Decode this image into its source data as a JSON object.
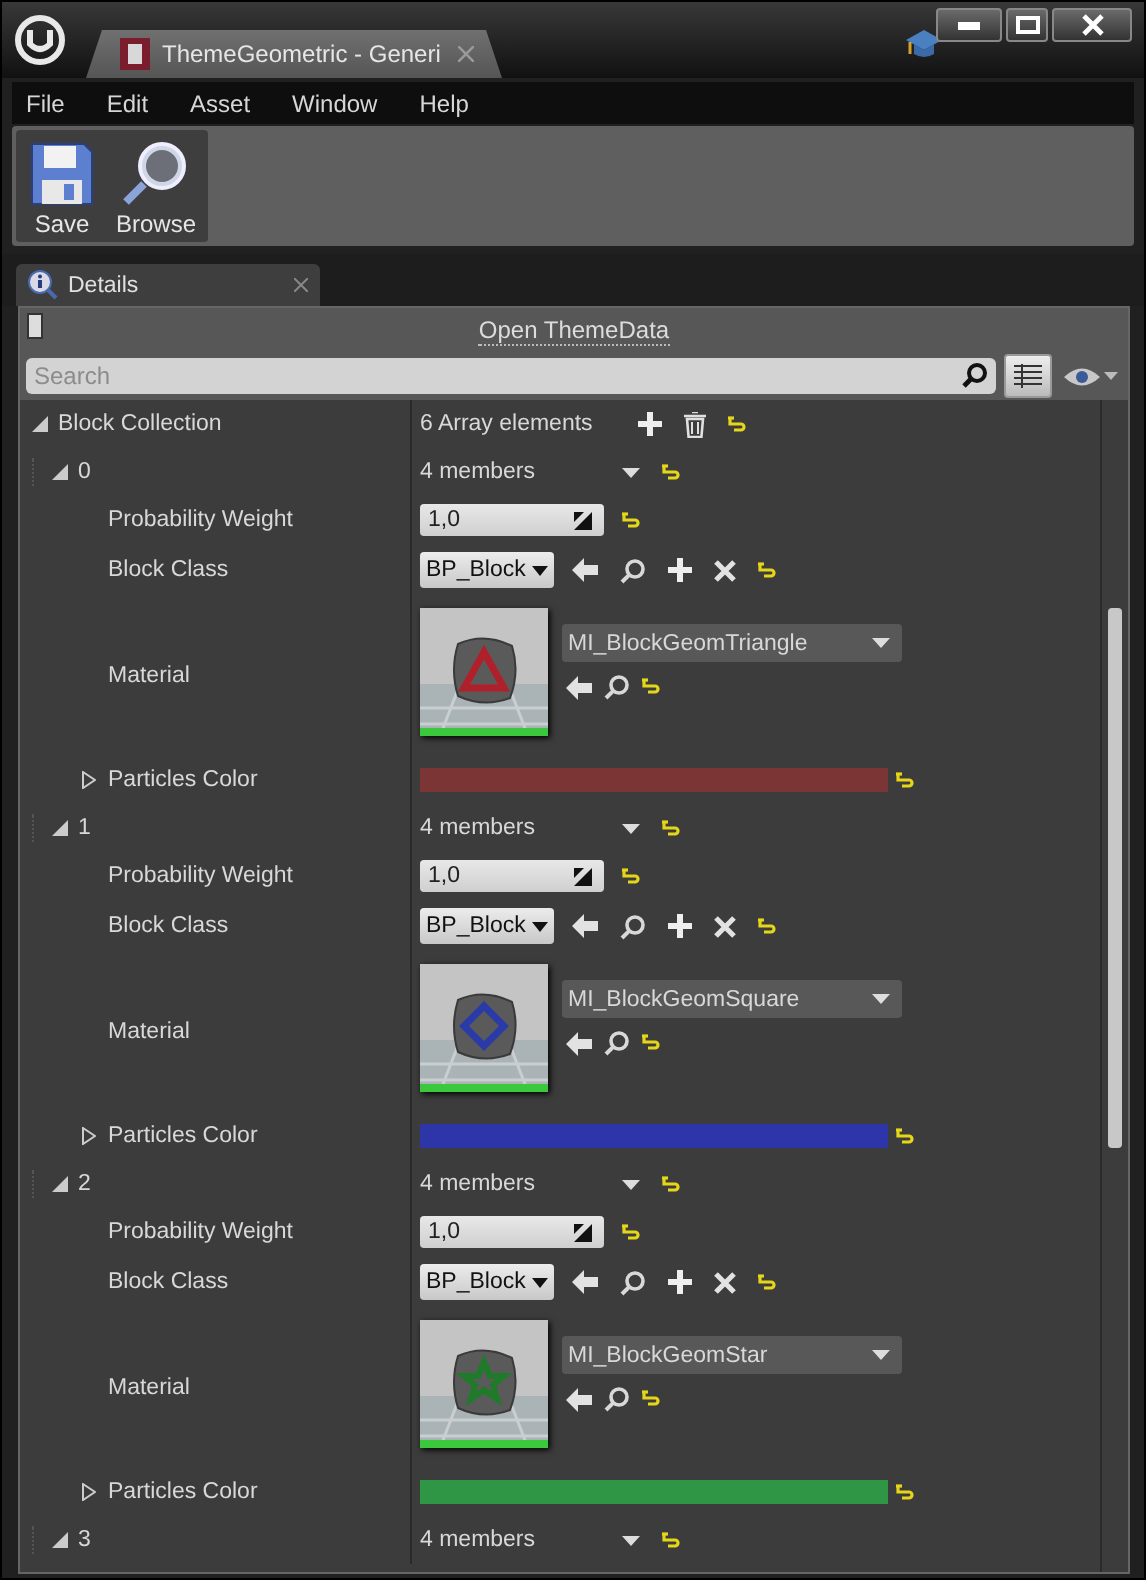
{
  "window": {
    "tab_title": "ThemeGeometric - Generi"
  },
  "menu": [
    "File",
    "Edit",
    "Asset",
    "Window",
    "Help"
  ],
  "toolbar": [
    {
      "kind": "save",
      "label": "Save"
    },
    {
      "kind": "browse",
      "label": "Browse"
    }
  ],
  "panel_tab": {
    "label": "Details"
  },
  "asset_link": "Open ThemeData",
  "search": {
    "placeholder": "Search"
  },
  "collection": {
    "label": "Block Collection",
    "value": "6 Array elements",
    "expanded": true
  },
  "elements": [
    {
      "index": "0",
      "expanded": true,
      "summary": "4 members",
      "properties": [
        {
          "kind": "number",
          "label": "Probability Weight",
          "value": "1,0"
        },
        {
          "kind": "class",
          "label": "Block Class",
          "value": "BP_Block"
        },
        {
          "kind": "material",
          "label": "Material",
          "value": "MI_BlockGeomTriangle"
        },
        {
          "kind": "color",
          "label": "Particles Color",
          "expanded": false,
          "color": "#7b3535"
        }
      ]
    },
    {
      "index": "1",
      "expanded": true,
      "summary": "4 members",
      "properties": [
        {
          "kind": "number",
          "label": "Probability Weight",
          "value": "1,0"
        },
        {
          "kind": "class",
          "label": "Block Class",
          "value": "BP_Block"
        },
        {
          "kind": "material",
          "label": "Material",
          "value": "MI_BlockGeomSquare"
        },
        {
          "kind": "color",
          "label": "Particles Color",
          "expanded": false,
          "color": "#2e35a8"
        }
      ]
    },
    {
      "index": "2",
      "expanded": true,
      "summary": "4 members",
      "properties": [
        {
          "kind": "number",
          "label": "Probability Weight",
          "value": "1,0"
        },
        {
          "kind": "class",
          "label": "Block Class",
          "value": "BP_Block"
        },
        {
          "kind": "material",
          "label": "Material",
          "value": "MI_BlockGeomStar"
        },
        {
          "kind": "color",
          "label": "Particles Color",
          "expanded": false,
          "color": "#2e9645"
        }
      ]
    },
    {
      "index": "3",
      "expanded": true,
      "summary": "4 members"
    }
  ]
}
